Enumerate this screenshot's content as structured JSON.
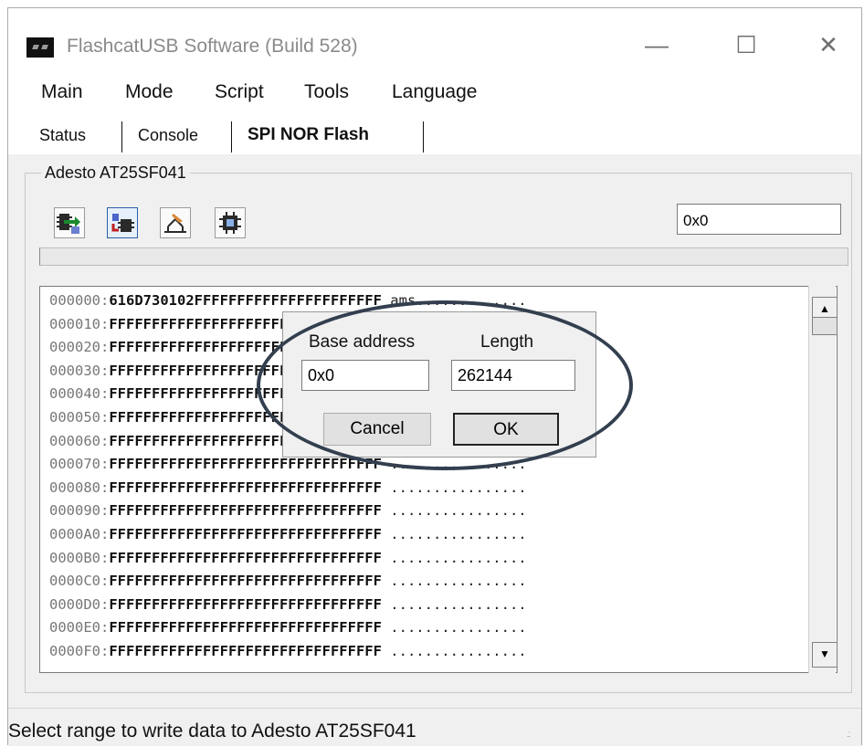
{
  "window": {
    "title": "FlashcatUSB Software (Build 528)",
    "controls": [
      "—",
      "☐",
      "✕"
    ]
  },
  "menu": [
    "Main",
    "Mode",
    "Script",
    "Tools",
    "Language"
  ],
  "tabs": [
    "Status",
    "Console",
    "SPI NOR Flash"
  ],
  "device_group": {
    "title": "Adesto AT25SF041",
    "address_value": "0x0",
    "toolbar_icons": [
      "read-chip-icon",
      "write-chip-icon",
      "erase-chip-icon",
      "verify-chip-icon"
    ]
  },
  "hex_view": {
    "rows": [
      {
        "addr": "000000:",
        "hex": "616D730102FFFFFFFFFFFFFFFFFFFFFF",
        "ascii": "ams............."
      },
      {
        "addr": "000010:",
        "hex": "FFFFFFFFFFFFFFFFFFFFFFFFFFFFFFFF",
        "ascii": "................"
      },
      {
        "addr": "000020:",
        "hex": "FFFFFFFFFFFFFFFFFFFFFFFFFFFFFFFF",
        "ascii": "................"
      },
      {
        "addr": "000030:",
        "hex": "FFFFFFFFFFFFFFFFFFFFFFFFFFFFFFFF",
        "ascii": "................"
      },
      {
        "addr": "000040:",
        "hex": "FFFFFFFFFFFFFFFFFFFFFFFFFFFFFFFF",
        "ascii": "................"
      },
      {
        "addr": "000050:",
        "hex": "FFFFFFFFFFFFFFFFFFFFFFFFFFFFFFFF",
        "ascii": "................"
      },
      {
        "addr": "000060:",
        "hex": "FFFFFFFFFFFFFFFFFFFFFFFFFFFFFFFF",
        "ascii": "................"
      },
      {
        "addr": "000070:",
        "hex": "FFFFFFFFFFFFFFFFFFFFFFFFFFFFFFFF",
        "ascii": "................"
      },
      {
        "addr": "000080:",
        "hex": "FFFFFFFFFFFFFFFFFFFFFFFFFFFFFFFF",
        "ascii": "................"
      },
      {
        "addr": "000090:",
        "hex": "FFFFFFFFFFFFFFFFFFFFFFFFFFFFFFFF",
        "ascii": "................"
      },
      {
        "addr": "0000A0:",
        "hex": "FFFFFFFFFFFFFFFFFFFFFFFFFFFFFFFF",
        "ascii": "................"
      },
      {
        "addr": "0000B0:",
        "hex": "FFFFFFFFFFFFFFFFFFFFFFFFFFFFFFFF",
        "ascii": "................"
      },
      {
        "addr": "0000C0:",
        "hex": "FFFFFFFFFFFFFFFFFFFFFFFFFFFFFFFF",
        "ascii": "................"
      },
      {
        "addr": "0000D0:",
        "hex": "FFFFFFFFFFFFFFFFFFFFFFFFFFFFFFFF",
        "ascii": "................"
      },
      {
        "addr": "0000E0:",
        "hex": "FFFFFFFFFFFFFFFFFFFFFFFFFFFFFFFF",
        "ascii": "................"
      },
      {
        "addr": "0000F0:",
        "hex": "FFFFFFFFFFFFFFFFFFFFFFFFFFFFFFFF",
        "ascii": "................"
      }
    ]
  },
  "range_dialog": {
    "base_label": "Base address",
    "length_label": "Length",
    "base_value": "0x0",
    "length_value": "262144",
    "cancel_label": "Cancel",
    "ok_label": "OK"
  },
  "status_bar": {
    "text": "Select range to write data to Adesto AT25SF041"
  },
  "colors": {
    "annotation_ellipse": "#333f4f"
  }
}
